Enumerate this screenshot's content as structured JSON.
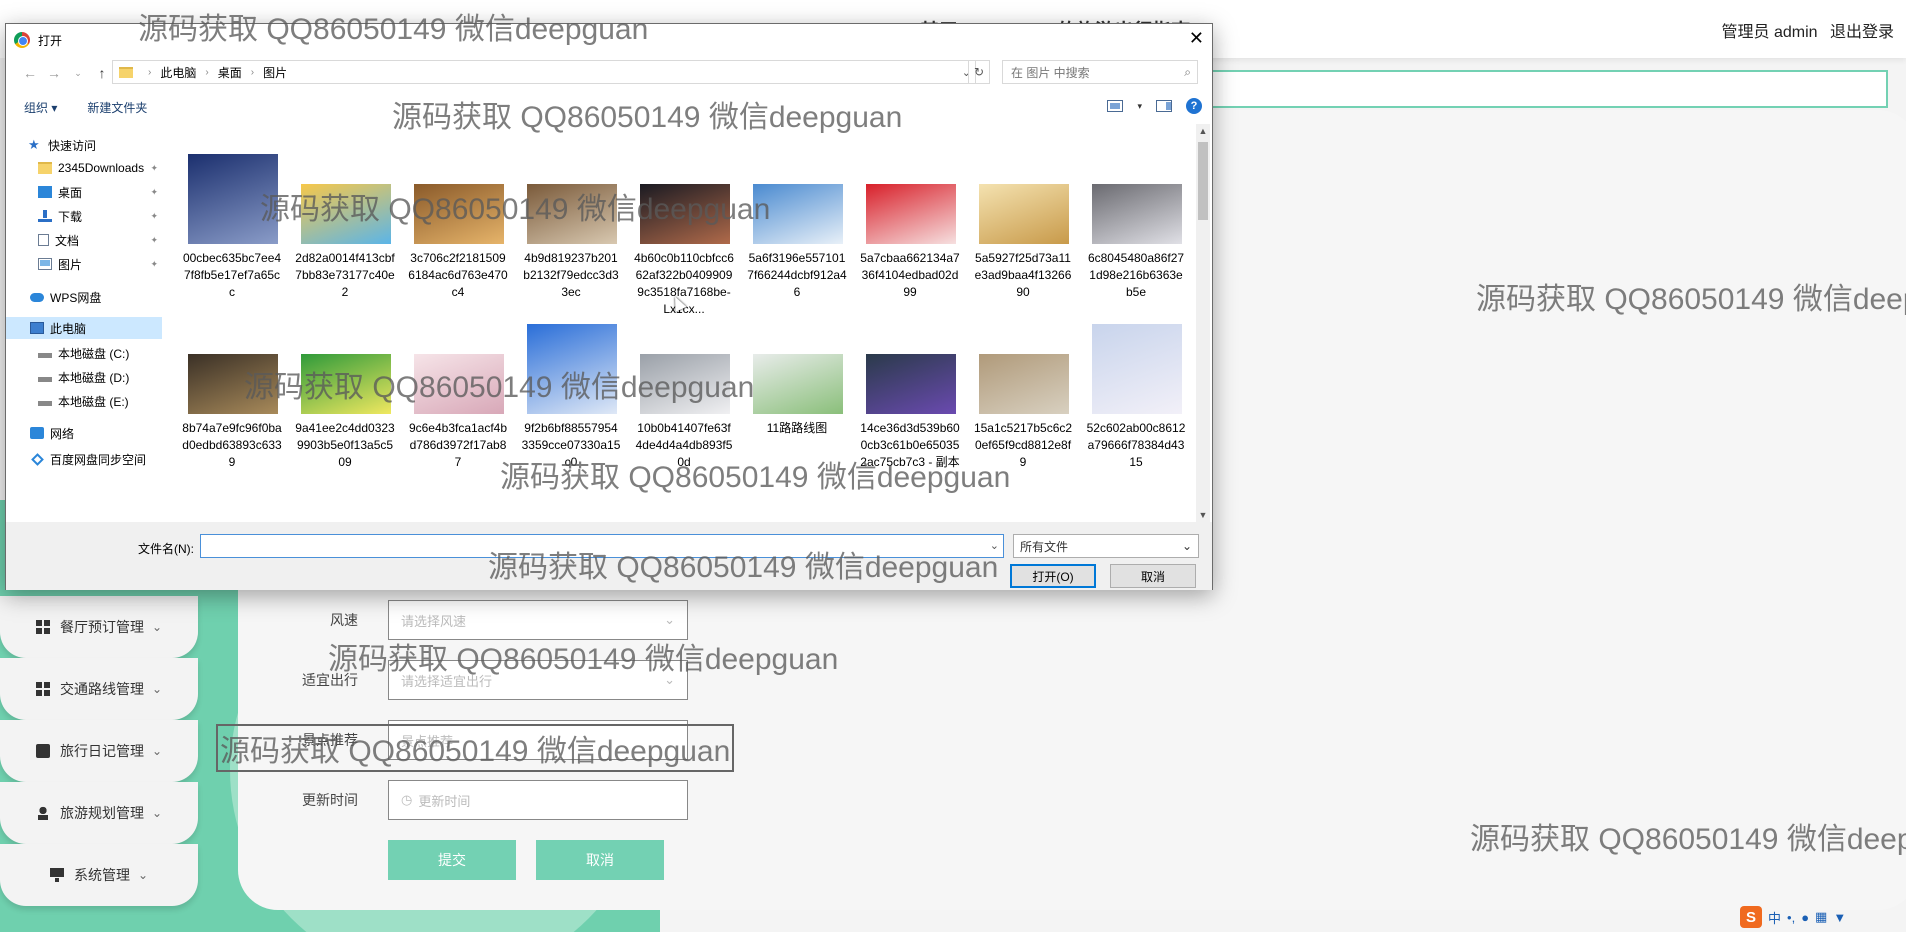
{
  "app": {
    "title": "基于springboot的旅游出行指南",
    "nav_home": "系统首页",
    "user_label": "管理员 admin",
    "logout_label": "退出登录"
  },
  "sidebar": {
    "items": [
      {
        "label": "餐厅预订管理",
        "icon": "grid-icon"
      },
      {
        "label": "交通路线管理",
        "icon": "grid-icon"
      },
      {
        "label": "旅行日记管理",
        "icon": "book-icon"
      },
      {
        "label": "旅游规划管理",
        "icon": "person-icon"
      },
      {
        "label": "系统管理",
        "icon": "monitor-icon"
      }
    ]
  },
  "form": {
    "wind": {
      "label": "风速",
      "placeholder": "请选择风速"
    },
    "suitable": {
      "label": "适宜出行",
      "placeholder": "请选择适宜出行"
    },
    "recommend": {
      "label": "景点推荐",
      "placeholder": "景点推荐"
    },
    "update_time": {
      "label": "更新时间",
      "placeholder": "更新时间"
    },
    "submit_label": "提交",
    "cancel_label": "取消"
  },
  "dialog": {
    "title": "打开",
    "breadcrumb": [
      "此电脑",
      "桌面",
      "图片"
    ],
    "search_placeholder": "在 图片 中搜索",
    "organize_label": "组织 ▾",
    "new_folder_label": "新建文件夹",
    "nav": {
      "quick_access": "快速访问",
      "items": [
        {
          "label": "2345Downloads",
          "icon": "folder-icon",
          "pinned": true
        },
        {
          "label": "桌面",
          "icon": "desktop-icon",
          "pinned": true
        },
        {
          "label": "下载",
          "icon": "download-icon",
          "pinned": true
        },
        {
          "label": "文档",
          "icon": "document-icon",
          "pinned": true
        },
        {
          "label": "图片",
          "icon": "pictures-icon",
          "pinned": true
        }
      ],
      "wps": "WPS网盘",
      "this_pc": "此电脑",
      "drives": [
        "本地磁盘 (C:)",
        "本地磁盘 (D:)",
        "本地磁盘 (E:)"
      ],
      "network": "网络",
      "baidu": "百度网盘同步空间"
    },
    "files": [
      {
        "name": "00cbec635bc7ee47f8fb5e17ef7a65cc",
        "colors": [
          "#1b2f6e",
          "#8a9cc8"
        ]
      },
      {
        "name": "2d82a0014f413cbf7bb83e73177c40e2",
        "colors": [
          "#f7c84a",
          "#5bb5e8"
        ]
      },
      {
        "name": "3c706c2f21815096184ac6d763e470c4",
        "colors": [
          "#8a5a2a",
          "#e6b46a"
        ]
      },
      {
        "name": "4b9d819237b201b2132f79edcc3d33ec",
        "colors": [
          "#7a5a3a",
          "#d8c8b0"
        ]
      },
      {
        "name": "4b60c0b110cbfcc662af322b04099099c3518fa7168be-Lx1cx...",
        "colors": [
          "#1a1a22",
          "#b06a4a"
        ]
      },
      {
        "name": "5a6f3196e5571017f66244dcbf912a46",
        "colors": [
          "#4a8ad0",
          "#e8f0f8"
        ]
      },
      {
        "name": "5a7cbaa662134a736f4104edbad02d99",
        "colors": [
          "#d8202a",
          "#f6e0e0"
        ]
      },
      {
        "name": "5a5927f25d73a11e3ad9baa4f1326690",
        "colors": [
          "#f4e2b0",
          "#c89a4a"
        ]
      },
      {
        "name": "6c8045480a86f271d98e216b6363eb5e",
        "colors": [
          "#6a6a70",
          "#e0e0e6"
        ]
      },
      {
        "name": "8b74a7e9fc96f0bad0edbd63893c6339",
        "colors": [
          "#3a3026",
          "#a88a5a"
        ]
      },
      {
        "name": "9a41ee2c4dd03239903b5e0f13a5c509",
        "colors": [
          "#2f9a3a",
          "#f0e860"
        ]
      },
      {
        "name": "9c6e4b3fca1acf4bd786d3972f17ab87",
        "colors": [
          "#f6e4e8",
          "#d8a8b8"
        ]
      },
      {
        "name": "9f2b6bf885579543359cce07330a15c0",
        "colors": [
          "#2a6ed8",
          "#dfe8f6"
        ]
      },
      {
        "name": "10b0b41407fe63f4de4d4a4db893f50d",
        "colors": [
          "#9aa0a8",
          "#f0f0f2"
        ]
      },
      {
        "name": "11路路线图",
        "colors": [
          "#e8ecea",
          "#8abf7a"
        ]
      },
      {
        "name": "14ce36d3d539b600cb3c61b0e650352ac75cb7c3 - 副本",
        "colors": [
          "#2a3a4a",
          "#6a4ab0"
        ]
      },
      {
        "name": "15a1c5217b5c6c20ef65f9cd8812e8f9",
        "colors": [
          "#b09a7a",
          "#d8d0c0"
        ]
      },
      {
        "name": "52c602ab00c8612a79666f78384d4315",
        "colors": [
          "#c8d4ec",
          "#f2f0f8"
        ]
      },
      {
        "name": "",
        "colors": [
          "#3a2a20",
          "#8a6a4a"
        ]
      },
      {
        "name": "",
        "colors": [
          "#2a2a30",
          "#e0c8b0"
        ]
      },
      {
        "name": "",
        "colors": [
          "#2a9a4a",
          "#e8f4ec"
        ]
      },
      {
        "name": "",
        "colors": [
          "#5a5a60",
          "#c8c8cc"
        ]
      },
      {
        "name": "",
        "colors": [
          "#6a4a3a",
          "#e8c8a8"
        ]
      },
      {
        "name": "",
        "colors": [
          "#3a3a3a",
          "#e8d8d0"
        ]
      },
      {
        "name": "",
        "colors": [
          "#707070",
          "#c0c0c0"
        ]
      },
      {
        "name": "",
        "colors": [
          "#6a6a6a",
          "#bcbcbc"
        ]
      },
      {
        "name": "",
        "colors": [
          "#4a3a2a",
          "#a89070"
        ]
      }
    ],
    "filename_label": "文件名(N):",
    "filename_value": "",
    "filetype": "所有文件",
    "open_label": "打开(O)",
    "cancel_label": "取消"
  },
  "watermark": "源码获取 QQ86050149 微信deepguan",
  "tray": {
    "ime": "中",
    "icons": [
      "punctuation-icon",
      "mic-icon",
      "keyboard-icon",
      "shirt-icon"
    ]
  },
  "colors": {
    "accent": "#73d1b3",
    "dialog_focus": "#0078d7"
  }
}
